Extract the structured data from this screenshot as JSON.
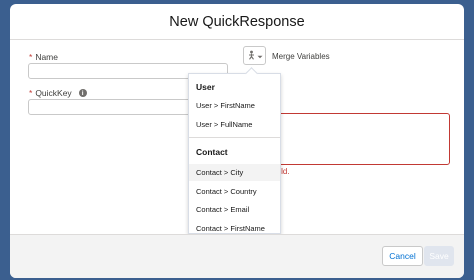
{
  "modal": {
    "title": "New QuickResponse"
  },
  "form": {
    "name_label": "Name",
    "name_required": "*",
    "name_value": "",
    "quickkey_label": "QuickKey",
    "quickkey_required": "*",
    "quickkey_value": "",
    "info_glyph": "i",
    "merge_variables_label": "Merge Variables",
    "error_text": "this field."
  },
  "merge_dropdown": {
    "groups": [
      {
        "label": "User",
        "items": [
          "User > FirstName",
          "User > FullName"
        ]
      },
      {
        "label": "Contact",
        "items": [
          "Contact > City",
          "Contact > Country",
          "Contact > Email",
          "Contact > FirstName"
        ]
      }
    ]
  },
  "footer": {
    "cancel_label": "Cancel",
    "save_label": "Save"
  },
  "colors": {
    "accent": "#0070d2",
    "error": "#c23934",
    "backdrop": "#3b5f8f"
  },
  "icons": {
    "merge": "person-merge-icon",
    "chevron": "chevron-down-icon",
    "info": "info-icon"
  }
}
